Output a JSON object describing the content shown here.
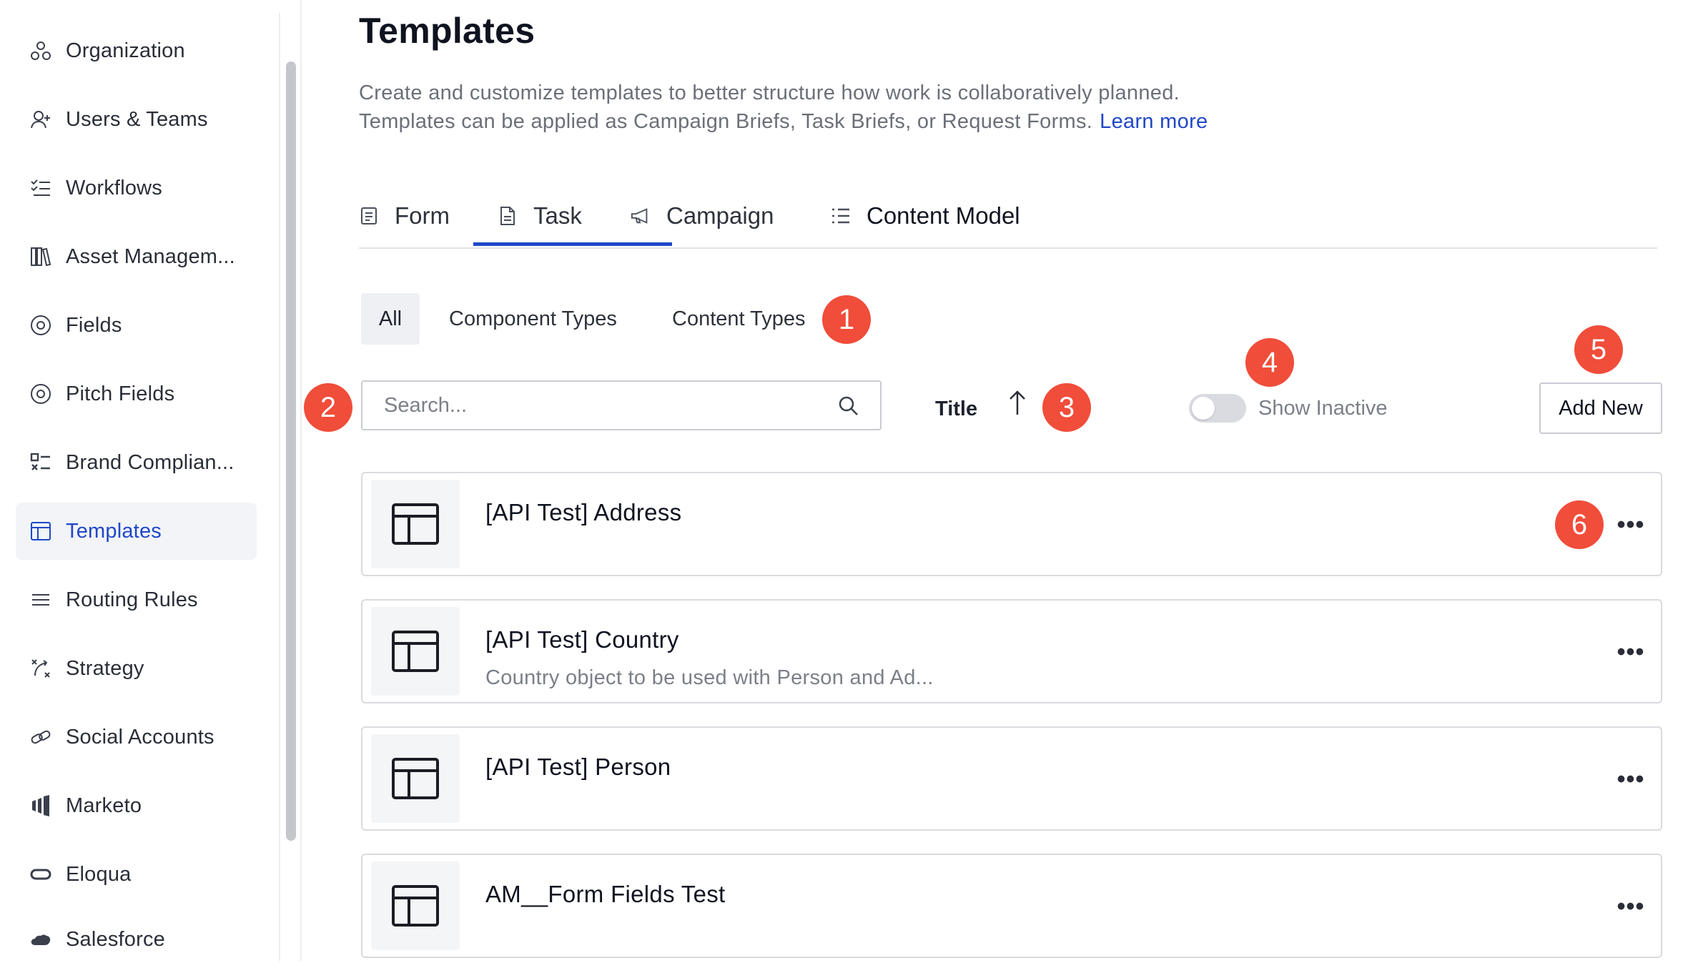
{
  "sidebar": {
    "items": [
      {
        "label": "Organization",
        "icon": "organization-icon"
      },
      {
        "label": "Users & Teams",
        "icon": "users-icon"
      },
      {
        "label": "Workflows",
        "icon": "workflows-icon"
      },
      {
        "label": "Asset Managem...",
        "icon": "library-icon"
      },
      {
        "label": "Fields",
        "icon": "fields-icon"
      },
      {
        "label": "Pitch Fields",
        "icon": "pitch-fields-icon"
      },
      {
        "label": "Brand Complian...",
        "icon": "brand-compliance-icon"
      },
      {
        "label": "Templates",
        "icon": "templates-icon",
        "active": true
      },
      {
        "label": "Routing Rules",
        "icon": "routing-icon"
      },
      {
        "label": "Strategy",
        "icon": "strategy-icon"
      },
      {
        "label": "Social Accounts",
        "icon": "link-icon"
      },
      {
        "label": "Marketo",
        "icon": "marketo-icon"
      },
      {
        "label": "Eloqua",
        "icon": "eloqua-icon"
      },
      {
        "label": "Salesforce",
        "icon": "salesforce-icon"
      }
    ]
  },
  "page": {
    "title": "Templates",
    "description_line1": "Create and customize templates to better structure how work is collaboratively planned.",
    "description_line2": "Templates can be applied as Campaign Briefs, Task Briefs, or Request Forms.",
    "learn_more": "Learn more"
  },
  "tabs": [
    {
      "label": "Form",
      "icon": "form-icon"
    },
    {
      "label": "Task",
      "icon": "task-icon"
    },
    {
      "label": "Campaign",
      "icon": "megaphone-icon"
    },
    {
      "label": "Content Model",
      "icon": "list-icon",
      "active": true
    }
  ],
  "filters": {
    "all": "All",
    "component_types": "Component Types",
    "content_types": "Content Types"
  },
  "search": {
    "placeholder": "Search..."
  },
  "sort": {
    "label": "Title",
    "direction": "ascending"
  },
  "show_inactive": {
    "label": "Show Inactive",
    "on": false
  },
  "add_new": "Add New",
  "badges": [
    "1",
    "2",
    "3",
    "4",
    "5",
    "6"
  ],
  "templates": [
    {
      "title": "[API Test] Address",
      "subtitle": ""
    },
    {
      "title": "[API Test] Country",
      "subtitle": "Country object to be used with Person and Ad..."
    },
    {
      "title": "[API Test] Person",
      "subtitle": ""
    },
    {
      "title": "AM__Form Fields Test",
      "subtitle": ""
    }
  ],
  "colors": {
    "accent": "#1f48c7",
    "badge": "#f04d3a"
  }
}
